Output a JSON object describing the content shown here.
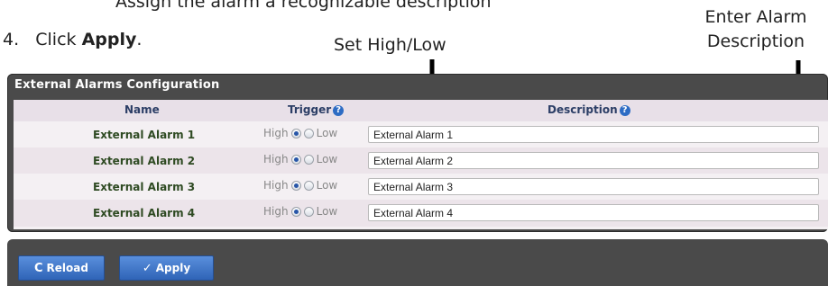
{
  "document": {
    "top_line": "Assign the alarm a recognizable description",
    "step_number": "4.",
    "step_prefix": "Click ",
    "step_bold": "Apply",
    "step_suffix": ".",
    "callout_trigger": "Set High/Low",
    "callout_description_line1": "Enter Alarm",
    "callout_description_line2": "Description"
  },
  "panel": {
    "title": "External Alarms Configuration",
    "columns": {
      "name": "Name",
      "trigger": "Trigger",
      "description": "Description"
    },
    "help_glyph": "?",
    "trigger_high_label": "High",
    "trigger_low_label": "Low",
    "rows": [
      {
        "name": "External Alarm 1",
        "trigger": "High",
        "description": "External Alarm 1"
      },
      {
        "name": "External Alarm 2",
        "trigger": "High",
        "description": "External Alarm 2"
      },
      {
        "name": "External Alarm 3",
        "trigger": "High",
        "description": "External Alarm 3"
      },
      {
        "name": "External Alarm 4",
        "trigger": "High",
        "description": "External Alarm 4"
      }
    ]
  },
  "toolbar": {
    "reload_icon": "C",
    "reload_label": "Reload",
    "apply_icon": "✓",
    "apply_label": "Apply"
  },
  "colors": {
    "panel_bg": "#4a4a4a",
    "button_blue": "#2f64b7",
    "name_text": "#2e4a22",
    "header_text": "#2c3e66"
  }
}
